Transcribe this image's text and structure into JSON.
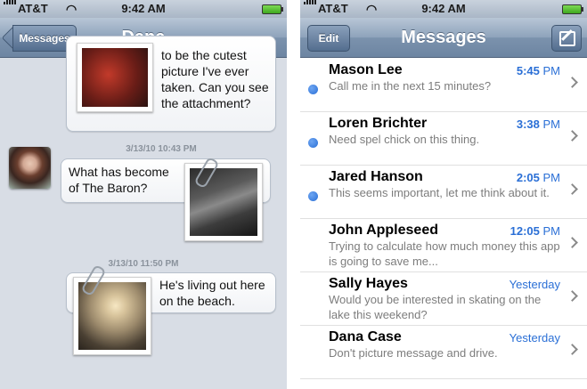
{
  "status_bar": {
    "carrier": "AT&T",
    "time": "9:42 AM"
  },
  "conversation": {
    "back_label": "Messages",
    "title": "Dana",
    "messages": [
      {
        "text": "to be the cutest picture I've ever taken. Can you see the attachment?"
      },
      {
        "timestamp": "3/13/10 10:43 PM",
        "text": "What has become of The Baron?"
      },
      {
        "timestamp": "3/13/10 11:50 PM",
        "text": "He's living out here on the beach."
      }
    ]
  },
  "inbox": {
    "edit_label": "Edit",
    "title": "Messages",
    "threads": [
      {
        "sender": "Mason Lee",
        "time": "5:45",
        "ampm": "PM",
        "preview": "Call me in the next 15 minutes?"
      },
      {
        "sender": "Loren Brichter",
        "time": "3:38",
        "ampm": "PM",
        "preview": "Need spel chick on this thing."
      },
      {
        "sender": "Jared Hanson",
        "time": "2:05",
        "ampm": "PM",
        "preview": "This seems important, let me think about it."
      },
      {
        "sender": "John Appleseed",
        "time": "12:05",
        "ampm": "PM",
        "preview": "Trying to calculate how much money this app is going to save me..."
      },
      {
        "sender": "Sally Hayes",
        "time": "Yesterday",
        "ampm": "",
        "preview": "Would you be interested in skating on the lake this weekend?"
      },
      {
        "sender": "Dana Case",
        "time": "Yesterday",
        "ampm": "",
        "preview": "Don't picture message and drive."
      }
    ]
  },
  "colors": {
    "accent_blue": "#2a6fd6",
    "nav_bar": "#6d85a2",
    "conversation_bg": "#d8dde5"
  },
  "icons": [
    "signal-icon",
    "wifi-icon",
    "battery-icon",
    "back-arrow-icon",
    "compose-icon",
    "unread-dot-icon",
    "chevron-right-icon",
    "paperclip-icon"
  ]
}
